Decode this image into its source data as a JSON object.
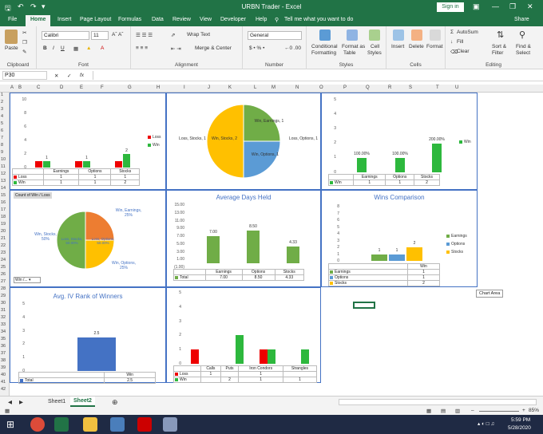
{
  "window": {
    "title": "URBN Trader - Excel",
    "signin": "Sign in",
    "share": "Share"
  },
  "tabs": [
    "File",
    "Home",
    "Insert",
    "Page Layout",
    "Formulas",
    "Data",
    "Review",
    "View",
    "Developer",
    "Help"
  ],
  "tellme": "Tell me what you want to do",
  "ribbon": {
    "paste": "Paste",
    "clipboard": "Clipboard",
    "font_name": "Calibri",
    "font_size": "11",
    "font_label": "Font",
    "wrap": "Wrap Text",
    "merge": "Merge & Center",
    "alignment": "Alignment",
    "numfmt": "General",
    "number": "Number",
    "cond": "Conditional",
    "cond2": "Formatting",
    "fmt_as": "Format as",
    "fmt_as2": "Table",
    "cell_styles": "Cell",
    "cell_styles2": "Styles",
    "styles": "Styles",
    "insert": "Insert",
    "delete": "Delete",
    "format": "Format",
    "cells": "Cells",
    "autosum": "AutoSum",
    "fill": "Fill",
    "clear": "Clear",
    "sort": "Sort &",
    "sort2": "Filter",
    "find": "Find &",
    "find2": "Select",
    "editing": "Editing"
  },
  "namebox": "P30",
  "fx": "fx",
  "columns": [
    "A",
    "B",
    "C",
    "D",
    "E",
    "F",
    "G",
    "H",
    "I",
    "J",
    "K",
    "L",
    "M",
    "N",
    "O",
    "P",
    "Q",
    "R",
    "S",
    "T",
    "U"
  ],
  "rows": [
    "1",
    "2",
    "3",
    "4",
    "5",
    "6",
    "7",
    "8",
    "9",
    "10",
    "11",
    "12",
    "13",
    "14",
    "15",
    "16",
    "17",
    "18",
    "19",
    "20",
    "21",
    "22",
    "23",
    "24",
    "25",
    "26",
    "27",
    "28",
    "29",
    "30",
    "31",
    "32",
    "33",
    "34",
    "35",
    "36",
    "37",
    "38",
    "39",
    "40",
    "41",
    "42"
  ],
  "charts": {
    "c1": {
      "ticks": [
        "10",
        "8",
        "6",
        "4",
        "2",
        "0"
      ],
      "cats": [
        "Earnings",
        "Options",
        "Stocks"
      ],
      "loss": [
        1,
        1,
        1
      ],
      "win": [
        1,
        1,
        2
      ],
      "loss_lbl": "Loss",
      "win_lbl": "Win",
      "legend": [
        "Loss",
        "Win"
      ]
    },
    "c2": {
      "slices": [
        {
          "label": "Win, Earnings, 1",
          "value": 1,
          "color": "#70ad47"
        },
        {
          "label": "Win, Options, 1",
          "value": 1,
          "color": "#5b9bd5"
        },
        {
          "label": "Win, Stocks, 2",
          "value": 2,
          "color": "#ffc000"
        }
      ],
      "outer_left": "Loss, Stocks, 1",
      "outer_right": "Loss, Options, 1"
    },
    "c3": {
      "ticks": [
        "5",
        "4",
        "3",
        "2",
        "1",
        "0"
      ],
      "cats": [
        "Earnings",
        "Options",
        "Stocks"
      ],
      "values": [
        1,
        1,
        2
      ],
      "pct": [
        "100.00%",
        "100.00%",
        "200.00%"
      ],
      "legend": "Win",
      "row_lbl": "Win"
    },
    "c4": {
      "field": "Count of Win / Loss",
      "filter": "Win /...",
      "slices": [
        {
          "label": "Win, Earnings, 25%",
          "inner": "",
          "value": 25,
          "color": "#ed7d31"
        },
        {
          "label": "Win, Options, 25%",
          "inner": "",
          "value": 25,
          "color": "#ffc000"
        },
        {
          "label": "Win, Stocks, 50%",
          "inner": "Loss, Stocks, 50.00%",
          "value": 50,
          "color": "#70ad47"
        }
      ],
      "inner_right": "Loss, Options, 50.00%"
    },
    "c5": {
      "title": "Average Days Held",
      "ticks": [
        "15.00",
        "13.00",
        "11.00",
        "9.00",
        "7.00",
        "5.00",
        "3.00",
        "1.00",
        "(1.00)"
      ],
      "cats": [
        "Earnings",
        "Options",
        "Stocks"
      ],
      "values": [
        7.0,
        8.5,
        4.33
      ],
      "labels": [
        "7.00",
        "8.50",
        "4.33"
      ],
      "row_lbl": "Total",
      "row_vals": [
        "7.00",
        "8.50",
        "4.33"
      ]
    },
    "c6": {
      "title": "Wins Comparison",
      "ticks": [
        "8",
        "7",
        "6",
        "5",
        "4",
        "3",
        "2",
        "1",
        "0"
      ],
      "cat": "Win",
      "series": [
        {
          "name": "Earnings",
          "value": 1,
          "color": "#70ad47"
        },
        {
          "name": "Options",
          "value": 1,
          "color": "#5b9bd5"
        },
        {
          "name": "Stocks",
          "value": 2,
          "color": "#ffc000"
        }
      ]
    },
    "c7": {
      "title": "Avg. IV Rank of Winners",
      "ticks": [
        "5",
        "4",
        "3",
        "2",
        "1",
        "0"
      ],
      "cat": "Win",
      "value": 2.5,
      "label": "2.5",
      "row_lbl": "Total",
      "row_val": "2.5"
    },
    "c8": {
      "ticks": [
        "5",
        "4",
        "3",
        "2",
        "1",
        "0"
      ],
      "cats": [
        "Calls",
        "Puts",
        "Iron Condors",
        "Strangles"
      ],
      "loss": [
        1,
        0,
        1,
        0
      ],
      "win": [
        0,
        2,
        1,
        1
      ],
      "loss_row": [
        "1",
        "",
        "1",
        ""
      ],
      "win_row": [
        "",
        "2",
        "1",
        "1"
      ],
      "loss_lbl": "Loss",
      "win_lbl": "Win"
    }
  },
  "chart_area_tip": "Chart Area",
  "sheets": [
    "Sheet1",
    "Sheet2"
  ],
  "zoom": "85%",
  "clock": {
    "time": "5:59 PM",
    "date": "5/28/2020"
  }
}
